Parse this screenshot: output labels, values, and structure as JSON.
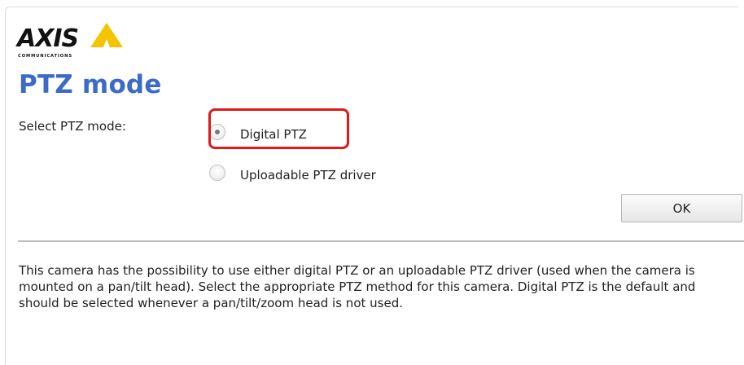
{
  "brand": {
    "name": "AXIS",
    "tagline": "COMMUNICATIONS",
    "accent_color": "#f5c400"
  },
  "page": {
    "title": "PTZ mode"
  },
  "form": {
    "label": "Select PTZ mode:",
    "options": [
      {
        "label": "Digital PTZ",
        "selected": true
      },
      {
        "label": "Uploadable PTZ driver",
        "selected": false
      }
    ],
    "ok_label": "OK",
    "highlight_color": "#e01818"
  },
  "help": {
    "text": "This camera has the possibility to use either digital PTZ or an uploadable PTZ driver (used when the camera is mounted on a pan/tilt head). Select the appropriate PTZ method for this camera. Digital PTZ is the default and should be selected whenever a pan/tilt/zoom head is not used."
  }
}
